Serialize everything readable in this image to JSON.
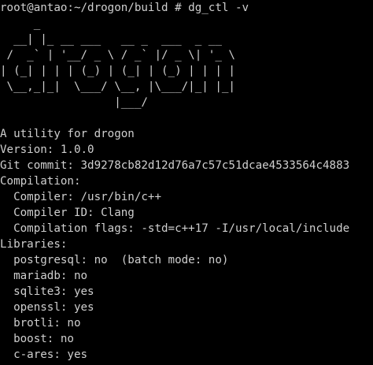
{
  "terminal": {
    "prompt": "root@antao:~/drogon/build # ",
    "command": "dg_ctl -v",
    "banner": [
      "     _",
      "  __| |_ __ ___   __ _  ___  _ __",
      " /  _` | '__/ _ \\ / _` |/ _ \\| '_ \\",
      "| (_| | | | (_) | (_| | (_) | | | |",
      " \\__,_|_|  \\___/ \\__, |\\___/|_| |_|",
      "                 |___/"
    ],
    "output": [
      "A utility for drogon",
      "Version: 1.0.0",
      "Git commit: 3d9278cb82d12d76a7c57c51dcae4533564c4883",
      "Compilation:",
      "  Compiler: /usr/bin/c++",
      "  Compiler ID: Clang",
      "  Compilation flags: -std=c++17 -I/usr/local/include",
      "Libraries:",
      "  postgresql: no  (batch mode: no)",
      "  mariadb: no",
      "  sqlite3: yes",
      "  openssl: yes",
      "  brotli: no",
      "  boost: no",
      "  c-ares: yes"
    ],
    "colors": {
      "background": "#000000",
      "foreground": "#cfcfcf"
    }
  }
}
